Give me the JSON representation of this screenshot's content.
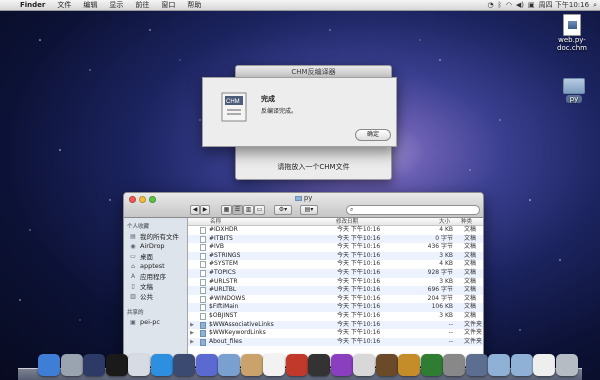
{
  "menubar": {
    "apple_glyph": "",
    "items": [
      "Finder",
      "文件",
      "编辑",
      "显示",
      "前往",
      "窗口",
      "帮助"
    ],
    "clock": "周四 下午10:16",
    "icons": [
      "wifi-icon",
      "volume-icon",
      "clock-icon",
      "time-machine-icon",
      "bluetooth-icon",
      "user-icon",
      "spotlight-icon"
    ]
  },
  "desktop": {
    "file_icon_label_1": "web.py-",
    "file_icon_label_2": "doc.chm",
    "folder_label": "py"
  },
  "chm_window": {
    "title": "CHM反编译器",
    "drop_text": "请拖放入一个CHM文件"
  },
  "alert": {
    "icon_text": "CHM",
    "title": "完成",
    "message": "反编译完成。",
    "ok_label": "确定"
  },
  "finder": {
    "title": "py",
    "search_placeholder": "",
    "sidebar": {
      "favorites_header": "个人收藏",
      "items": [
        {
          "label": "我的所有文件",
          "icon": "all-files-icon"
        },
        {
          "label": "AirDrop",
          "icon": "airdrop-icon"
        },
        {
          "label": "桌面",
          "icon": "desktop-icon"
        },
        {
          "label": "apptest",
          "icon": "home-icon"
        },
        {
          "label": "应用程序",
          "icon": "applications-icon"
        },
        {
          "label": "文稿",
          "icon": "documents-icon"
        },
        {
          "label": "公共",
          "icon": "public-icon"
        }
      ],
      "shared_header": "共享的",
      "shared_items": [
        {
          "label": "pei-pc",
          "icon": "computer-icon"
        }
      ]
    },
    "columns": {
      "name": "名称",
      "date": "修改日期",
      "size": "大小",
      "kind": "种类"
    },
    "rows": [
      {
        "name": "#IDXHDR",
        "date": "今天 下午10:16",
        "size": "4 KB",
        "kind": "文稿",
        "folder": false
      },
      {
        "name": "#ITBITS",
        "date": "今天 下午10:16",
        "size": "0 字节",
        "kind": "文稿",
        "folder": false
      },
      {
        "name": "#IVB",
        "date": "今天 下午10:16",
        "size": "436 字节",
        "kind": "文稿",
        "folder": false
      },
      {
        "name": "#STRINGS",
        "date": "今天 下午10:16",
        "size": "3 KB",
        "kind": "文稿",
        "folder": false
      },
      {
        "name": "#SYSTEM",
        "date": "今天 下午10:16",
        "size": "4 KB",
        "kind": "文稿",
        "folder": false
      },
      {
        "name": "#TOPICS",
        "date": "今天 下午10:16",
        "size": "928 字节",
        "kind": "文稿",
        "folder": false
      },
      {
        "name": "#URLSTR",
        "date": "今天 下午10:16",
        "size": "3 KB",
        "kind": "文稿",
        "folder": false
      },
      {
        "name": "#URLTBL",
        "date": "今天 下午10:16",
        "size": "696 字节",
        "kind": "文稿",
        "folder": false
      },
      {
        "name": "#WINDOWS",
        "date": "今天 下午10:16",
        "size": "204 字节",
        "kind": "文稿",
        "folder": false
      },
      {
        "name": "$FIftiMain",
        "date": "今天 下午10:16",
        "size": "106 KB",
        "kind": "文稿",
        "folder": false
      },
      {
        "name": "$OBJINST",
        "date": "今天 下午10:16",
        "size": "3 KB",
        "kind": "文稿",
        "folder": false
      },
      {
        "name": "$WWAssociativeLinks",
        "date": "今天 下午10:16",
        "size": "--",
        "kind": "文件夹",
        "folder": true
      },
      {
        "name": "$WWKeywordLinks",
        "date": "今天 下午10:16",
        "size": "--",
        "kind": "文件夹",
        "folder": true
      },
      {
        "name": "About_files",
        "date": "今天 下午10:16",
        "size": "--",
        "kind": "文件夹",
        "folder": true
      }
    ]
  },
  "colors": {
    "menubar": "#e4e4e4",
    "sidebar_bg": "#dde4ec",
    "row_stripe": "#edf3fe",
    "close": "#ee5b55",
    "minimize": "#f4bd3e",
    "zoom": "#5dc344"
  },
  "dock": {
    "icons": [
      "finder-icon",
      "launchpad-icon",
      "mission-control-icon",
      "dashboard-icon",
      "preview-icon",
      "safari-icon",
      "facetime-icon",
      "itunes-icon",
      "mail-icon",
      "address-book-icon",
      "calendar-icon",
      "photo-booth-icon",
      "terminal-icon",
      "itunes-store-icon",
      "flip-icon",
      "photo-icon",
      "garageband-icon",
      "time-machine-icon",
      "system-preferences-icon",
      "chm-app-icon",
      "downloads-folder-icon",
      "documents-folder-icon",
      "file-icon",
      "trash-icon"
    ]
  }
}
